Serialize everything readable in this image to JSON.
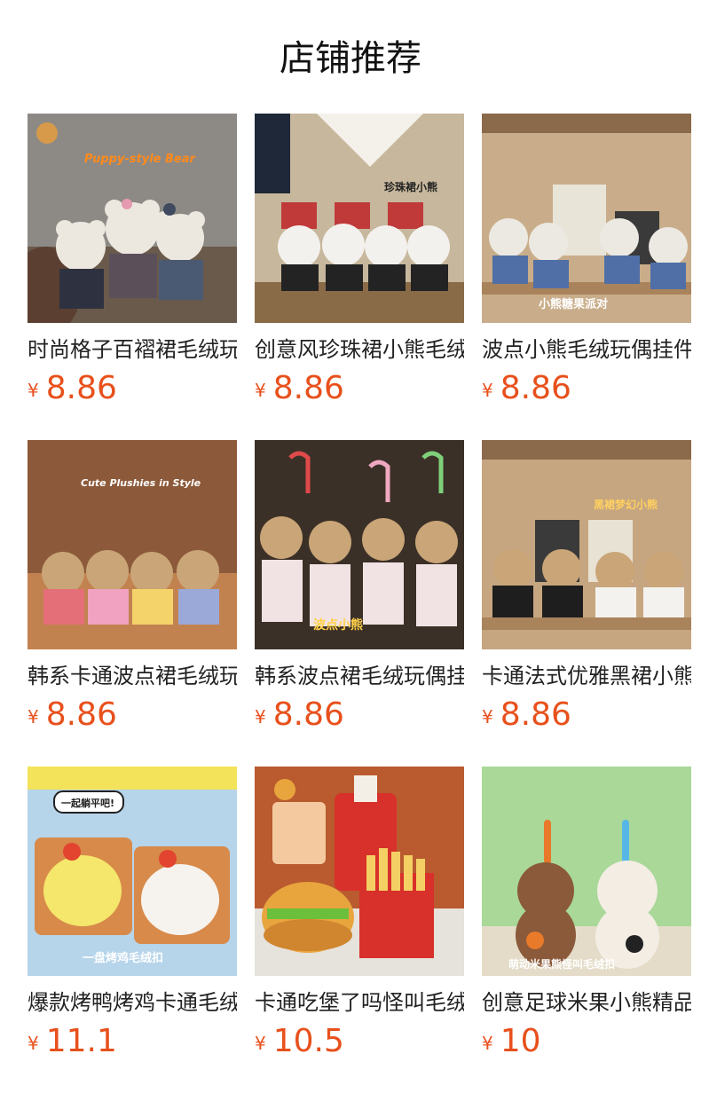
{
  "header": {
    "title": "店铺推荐"
  },
  "products": [
    {
      "name": "时尚格子百褶裙毛绒玩偶挂件",
      "currency": "¥",
      "price": "8.86",
      "image_text": "Puppy-style Bear"
    },
    {
      "name": "创意风珍珠裙小熊毛绒挂件",
      "currency": "¥",
      "price": "8.86",
      "image_text": "珍珠裙小熊"
    },
    {
      "name": "波点小熊毛绒玩偶挂件",
      "currency": "¥",
      "price": "8.86",
      "image_text": "小熊糖果派对"
    },
    {
      "name": "韩系卡通波点裙毛绒玩偶挂件",
      "currency": "¥",
      "price": "8.86",
      "image_text": "Cute Plushies in Style"
    },
    {
      "name": "韩系波点裙毛绒玩偶挂件",
      "currency": "¥",
      "price": "8.86",
      "image_text": "波点小熊"
    },
    {
      "name": "卡通法式优雅黑裙小熊挂件",
      "currency": "¥",
      "price": "8.86",
      "image_text": "黑裙梦幻小熊"
    },
    {
      "name": "爆款烤鸭烤鸡卡通毛绒挂件",
      "currency": "¥",
      "price": "11.1",
      "image_text": "一盘烤鸡毛绒扣",
      "badge_text": "一起躺平吧!"
    },
    {
      "name": "卡通吃堡了吗怪叫毛绒挂件",
      "currency": "¥",
      "price": "10.5"
    },
    {
      "name": "创意足球米果小熊精品挂件",
      "currency": "¥",
      "price": "10",
      "image_text": "萌动米果熊怪叫毛绒扣"
    }
  ],
  "colors": {
    "price": "#e8501c",
    "title": "#111111",
    "name": "#222222"
  }
}
